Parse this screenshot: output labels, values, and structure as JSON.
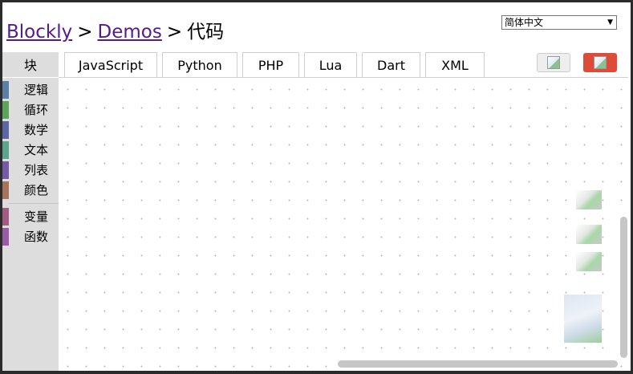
{
  "breadcrumb": {
    "link1": "Blockly",
    "sep1": ">",
    "link2": "Demos",
    "sep2": ">",
    "current": "代码"
  },
  "language": {
    "selected": "简体中文",
    "arrow": "▼"
  },
  "tabs": [
    {
      "label": "块"
    },
    {
      "label": "JavaScript"
    },
    {
      "label": "Python"
    },
    {
      "label": "PHP"
    },
    {
      "label": "Lua"
    },
    {
      "label": "Dart"
    },
    {
      "label": "XML"
    }
  ],
  "selected_tab": "块",
  "buttons": {
    "trash": {
      "icon": "broken-image-icon"
    },
    "run": {
      "icon": "broken-image-icon"
    }
  },
  "toolbox": {
    "categories": [
      {
        "label": "逻辑",
        "color": "#5b80a5"
      },
      {
        "label": "循环",
        "color": "#5ba55b"
      },
      {
        "label": "数学",
        "color": "#5b67a5"
      },
      {
        "label": "文本",
        "color": "#5ba58c"
      },
      {
        "label": "列表",
        "color": "#745ba5"
      },
      {
        "label": "颜色",
        "color": "#a5745b"
      },
      {
        "label": "变量",
        "color": "#a55b80"
      },
      {
        "label": "函数",
        "color": "#995ba5"
      }
    ]
  },
  "colors": {
    "run_button": "#dd4b39",
    "link": "#551a8b"
  }
}
